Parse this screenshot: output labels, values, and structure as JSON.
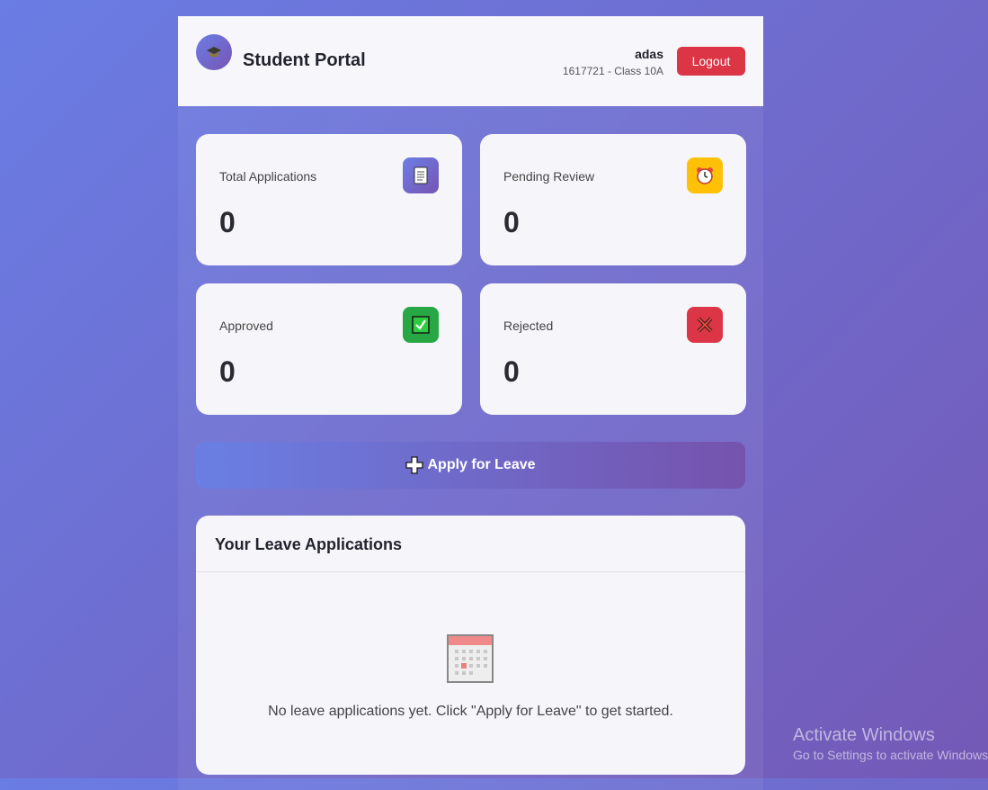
{
  "header": {
    "title": "Student Portal",
    "logo_icon": "graduation-cap-icon",
    "user_name": "adas",
    "user_info": "1617721 - Class 10A",
    "logout_label": "Logout"
  },
  "stats": [
    {
      "label": "Total Applications",
      "value": "0",
      "icon": "document-icon",
      "color": "#7063c8"
    },
    {
      "label": "Pending Review",
      "value": "0",
      "icon": "alarm-clock-icon",
      "color": "#ffc107"
    },
    {
      "label": "Approved",
      "value": "0",
      "icon": "check-box-icon",
      "color": "#28a745"
    },
    {
      "label": "Rejected",
      "value": "0",
      "icon": "cross-icon",
      "color": "#dc3545"
    }
  ],
  "apply_button": {
    "label": "Apply for Leave",
    "icon": "plus-icon"
  },
  "applications": {
    "title": "Your Leave Applications",
    "empty_icon": "calendar-icon",
    "empty_text": "No leave applications yet. Click \"Apply for Leave\" to get started."
  },
  "watermark": {
    "title": "Activate Windows",
    "subtitle": "Go to Settings to activate Windows."
  },
  "colors": {
    "accent_start": "#6a7de4",
    "accent_end": "#7459b6",
    "logout": "#dc3545"
  }
}
